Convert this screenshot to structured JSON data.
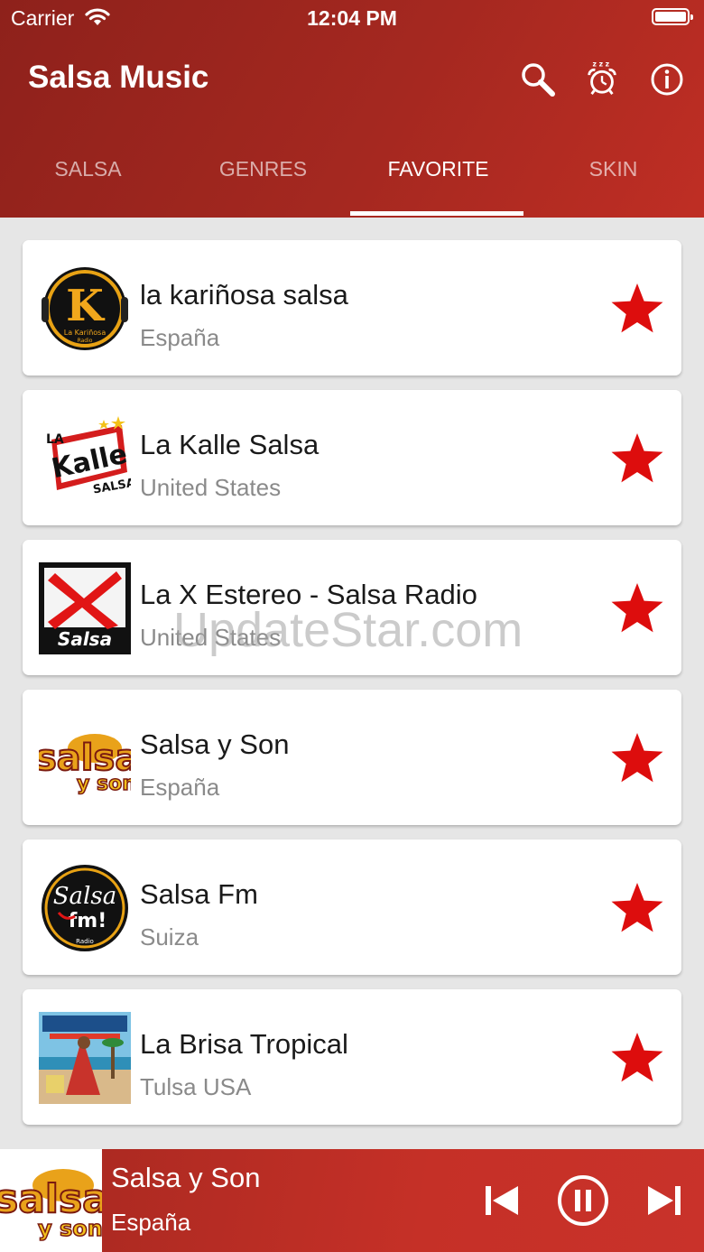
{
  "status_bar": {
    "carrier": "Carrier",
    "time": "12:04 PM"
  },
  "header": {
    "title": "Salsa Music"
  },
  "tabs": [
    {
      "label": "SALSA",
      "active": false
    },
    {
      "label": "GENRES",
      "active": false
    },
    {
      "label": "FAVORITE",
      "active": true
    },
    {
      "label": "SKIN",
      "active": false
    }
  ],
  "stations": [
    {
      "name": "la kariñosa salsa",
      "country": "España",
      "logo": "la-karinosa-radio-logo",
      "favorite": true
    },
    {
      "name": "La Kalle Salsa",
      "country": "United States",
      "logo": "la-kalle-salsa-logo",
      "favorite": true
    },
    {
      "name": "La X Estereo - Salsa Radio",
      "country": "United States",
      "logo": "x-salsa-logo",
      "favorite": true
    },
    {
      "name": "Salsa y Son",
      "country": "España",
      "logo": "salsa-y-son-logo",
      "favorite": true
    },
    {
      "name": "Salsa Fm",
      "country": "Suiza",
      "logo": "salsa-fm-radio-logo",
      "favorite": true
    },
    {
      "name": "La Brisa Tropical",
      "country": "Tulsa USA",
      "logo": "la-brisa-tropical-logo",
      "favorite": true
    }
  ],
  "watermark": "UpdateStar.com",
  "player": {
    "title": "Salsa y Son",
    "subtitle": "España",
    "state": "playing"
  },
  "colors": {
    "header": "#a52820",
    "star": "#dd0d0d",
    "background": "#e6e6e6"
  }
}
